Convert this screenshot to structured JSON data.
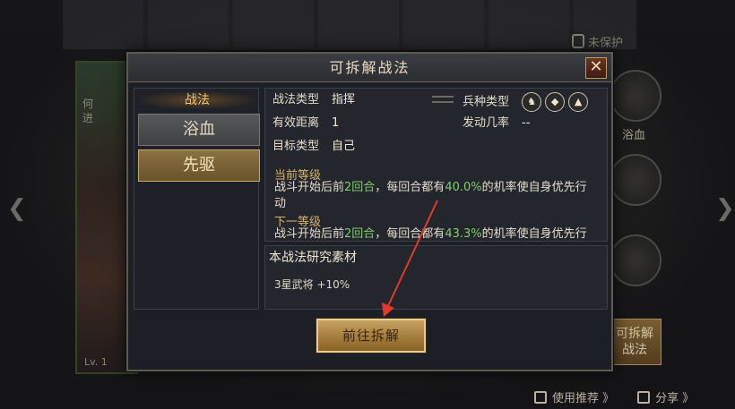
{
  "background": {
    "lock_label": "未保护",
    "card_side_text": "何进",
    "card_level": "Lv. 1",
    "side_skill_label": "浴血",
    "side_button_line1": "可拆解",
    "side_button_line2": "战法",
    "bottom_recommend": "使用推荐 》",
    "bottom_share": "分享 》"
  },
  "dialog": {
    "title": "可拆解战法",
    "close_symbol": "✕",
    "left": {
      "header": "战法",
      "skills": [
        {
          "label": "浴血",
          "active": false
        },
        {
          "label": "先驱",
          "active": true
        }
      ]
    },
    "info": {
      "type_label": "战法类型",
      "type_value": "指挥",
      "range_label": "有效距离",
      "range_value": "1",
      "target_label": "目标类型",
      "target_value": "自己",
      "troop_label": "兵种类型",
      "trigger_label": "发动几率",
      "trigger_value": "--"
    },
    "desc": {
      "current_title": "当前等级",
      "current_pre": "战斗开始后前",
      "current_rounds": "2回合",
      "current_mid": "，每回合都有",
      "current_rate": "40.0%",
      "current_post": "的机率使自身优先行",
      "current_wrap": "动",
      "next_title": "下一等级",
      "next_pre": "战斗开始后前",
      "next_rounds": "2回合",
      "next_mid": "，每回合都有",
      "next_rate": "43.3%",
      "next_post": "的机率使自身优先行"
    },
    "material": {
      "title": "本战法研究素材",
      "item": "3星武将  +10%"
    },
    "action_button": "前往拆解"
  },
  "colors": {
    "highlight_green": "#7dcf6a",
    "gold_text": "#d7b46a",
    "annotation_red": "#e23a2a"
  }
}
